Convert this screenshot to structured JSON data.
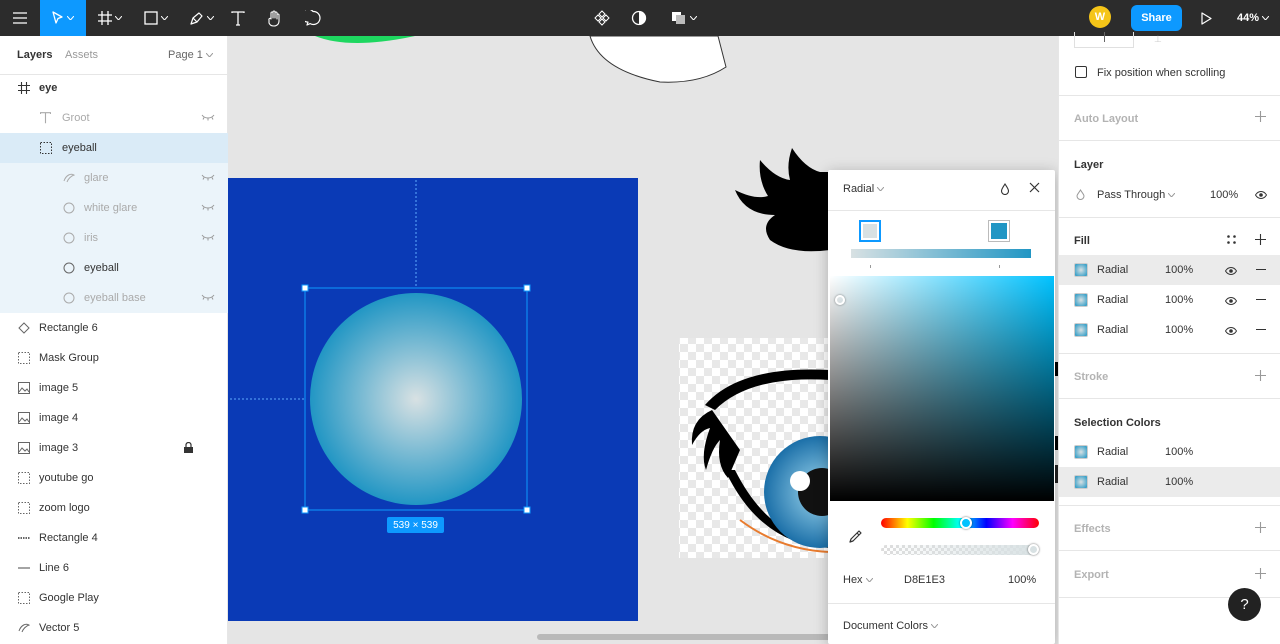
{
  "toolbar": {
    "zoom": "44%",
    "share_label": "Share",
    "avatar_initial": "W"
  },
  "layers_panel": {
    "tab_layers": "Layers",
    "tab_assets": "Assets",
    "page": "Page 1",
    "items": [
      {
        "name": "eye",
        "icon": "frame-icon"
      },
      {
        "name": "Groot",
        "icon": "text-icon"
      },
      {
        "name": "eyeball",
        "icon": "group-icon"
      },
      {
        "name": "glare",
        "icon": "vector-icon"
      },
      {
        "name": "white glare",
        "icon": "ellipse-icon"
      },
      {
        "name": "iris",
        "icon": "ellipse-icon"
      },
      {
        "name": "eyeball",
        "icon": "ellipse-icon"
      },
      {
        "name": "eyeball base",
        "icon": "ellipse-icon"
      },
      {
        "name": "Rectangle 6",
        "icon": "rectangle-icon"
      },
      {
        "name": "Mask Group",
        "icon": "group-icon"
      },
      {
        "name": "image 5",
        "icon": "image-icon"
      },
      {
        "name": "image 4",
        "icon": "image-icon"
      },
      {
        "name": "image 3",
        "icon": "image-icon"
      },
      {
        "name": "youtube go",
        "icon": "group-icon"
      },
      {
        "name": "zoom logo",
        "icon": "group-icon"
      },
      {
        "name": "Rectangle 4",
        "icon": "rectangle-icon"
      },
      {
        "name": "Line 6",
        "icon": "line-icon"
      },
      {
        "name": "Google Play",
        "icon": "group-icon"
      },
      {
        "name": "Vector 5",
        "icon": "vector-icon"
      }
    ]
  },
  "canvas": {
    "dimension_badge": "539 × 539",
    "colors": {
      "frame_blue": "#0a3ab6",
      "eyeball_center": "#d8e1e3",
      "eyeball_edge": "#2196c4",
      "selection": "#0d99ff"
    }
  },
  "color_picker": {
    "mode": "Radial",
    "hex_label": "Hex",
    "hex_value": "D8E1E3",
    "opacity": "100%",
    "document_colors": "Document Colors",
    "stop_colors": [
      "#d8e1e3",
      "#2196c4"
    ]
  },
  "right_panel": {
    "fix_position": "Fix position when scrolling",
    "auto_layout": "Auto Layout",
    "layer_title": "Layer",
    "blend_mode": "Pass Through",
    "layer_opacity": "100%",
    "fill_title": "Fill",
    "fills": [
      {
        "type": "Radial",
        "opacity": "100%"
      },
      {
        "type": "Radial",
        "opacity": "100%"
      },
      {
        "type": "Radial",
        "opacity": "100%"
      }
    ],
    "stroke_title": "Stroke",
    "selection_colors_title": "Selection Colors",
    "selection_colors": [
      {
        "type": "Radial",
        "opacity": "100%"
      },
      {
        "type": "Radial",
        "opacity": "100%"
      }
    ],
    "effects_title": "Effects",
    "export_title": "Export",
    "help": "?"
  }
}
